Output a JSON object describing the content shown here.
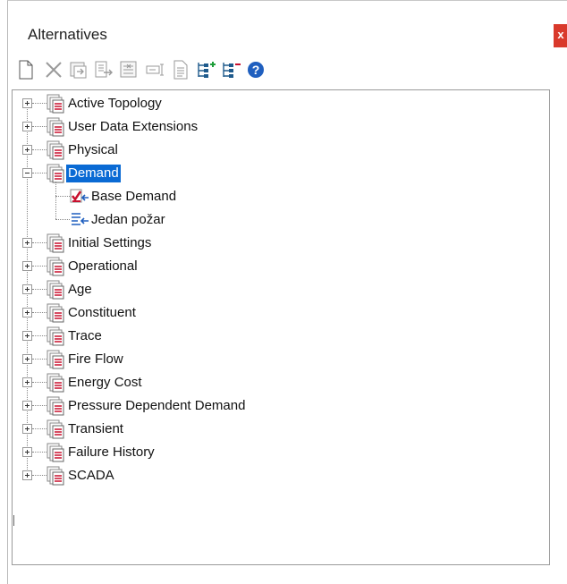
{
  "window": {
    "title": "Alternatives",
    "close_label": "x"
  },
  "toolbar": {
    "buttons": [
      {
        "name": "new-icon"
      },
      {
        "name": "delete-icon"
      },
      {
        "name": "rename-icon"
      },
      {
        "name": "merge-icon"
      },
      {
        "name": "compare-icon"
      },
      {
        "name": "edit-icon"
      },
      {
        "name": "report-icon"
      },
      {
        "name": "expand-all-icon"
      },
      {
        "name": "collapse-all-icon"
      },
      {
        "name": "help-icon"
      }
    ]
  },
  "tree": {
    "items": [
      {
        "label": "Active Topology",
        "expanded": false
      },
      {
        "label": "User Data Extensions",
        "expanded": false
      },
      {
        "label": "Physical",
        "expanded": false
      },
      {
        "label": "Demand",
        "expanded": true,
        "selected": true,
        "children": [
          {
            "label": "Base Demand",
            "icon": "base-alternative-icon"
          },
          {
            "label": "Jedan požar",
            "icon": "child-alternative-icon"
          }
        ]
      },
      {
        "label": "Initial Settings",
        "expanded": false
      },
      {
        "label": "Operational",
        "expanded": false
      },
      {
        "label": "Age",
        "expanded": false
      },
      {
        "label": "Constituent",
        "expanded": false
      },
      {
        "label": "Trace",
        "expanded": false
      },
      {
        "label": "Fire Flow",
        "expanded": false
      },
      {
        "label": "Energy Cost",
        "expanded": false
      },
      {
        "label": "Pressure Dependent Demand",
        "expanded": false
      },
      {
        "label": "Transient",
        "expanded": false
      },
      {
        "label": "Failure History",
        "expanded": false
      },
      {
        "label": "SCADA",
        "expanded": false
      }
    ]
  },
  "colors": {
    "selection": "#0a6ad4",
    "close_button": "#d9392b",
    "icon_red": "#c8102e",
    "icon_blue": "#1f5fbf",
    "icon_green": "#1e9e3a"
  }
}
